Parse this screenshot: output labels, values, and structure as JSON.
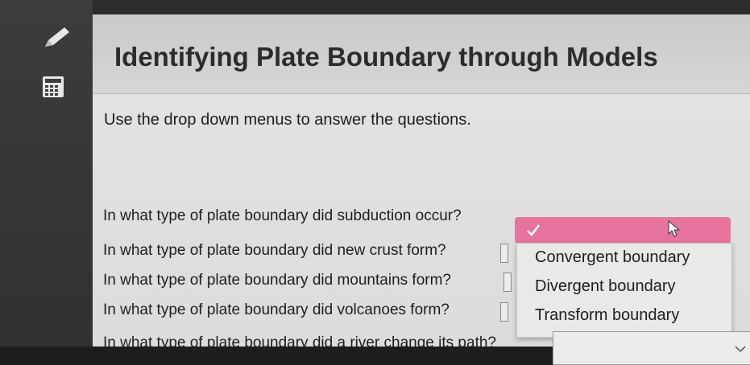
{
  "title": "Identifying Plate Boundary through Models",
  "instructions": "Use the drop down menus to answer the questions.",
  "questions": [
    "In what type of plate boundary did subduction occur?",
    "In what type of plate boundary did new crust form?",
    "In what type of plate boundary did mountains form?",
    "In what type of plate boundary did volcanoes form?",
    "In what type of plate boundary did a river change its path?"
  ],
  "dropdown_options": [
    "Convergent boundary",
    "Divergent boundary",
    "Transform boundary"
  ],
  "colors": {
    "dropdown_highlight": "#e6749e",
    "panel_background": "#e4e4e2",
    "title_text": "#2c2c2c"
  },
  "icons": [
    "pencil-icon",
    "calculator-icon",
    "check-icon",
    "cursor-icon",
    "chevron-down-icon"
  ]
}
